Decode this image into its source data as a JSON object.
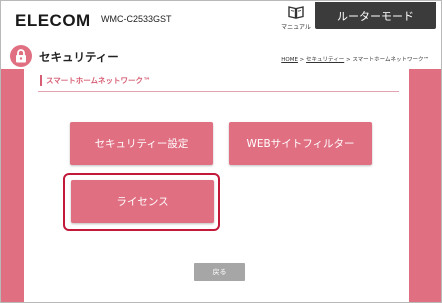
{
  "header": {
    "logo": "ELECOM",
    "model": "WMC-C2533GST",
    "manual_label": "マニュアル",
    "mode_button": "ルーターモード"
  },
  "section": {
    "title": "セキュリティー",
    "breadcrumb": {
      "home": "HOME",
      "separator": " > ",
      "security": "セキュリティー",
      "current": "スマートホームネットワーク™"
    }
  },
  "panel": {
    "title": "スマートホームネットワーク™",
    "buttons": {
      "security_settings": "セキュリティー設定",
      "web_filter": "WEBサイトフィルター",
      "license": "ライセンス"
    },
    "back_button": "戻る"
  },
  "colors": {
    "accent": "#e06f82",
    "highlight": "#c2193a",
    "mode_button_bg": "#3b3b3b",
    "back_button_bg": "#a6a6a6"
  },
  "icons": {
    "manual": "book-icon",
    "section": "lock-icon"
  }
}
